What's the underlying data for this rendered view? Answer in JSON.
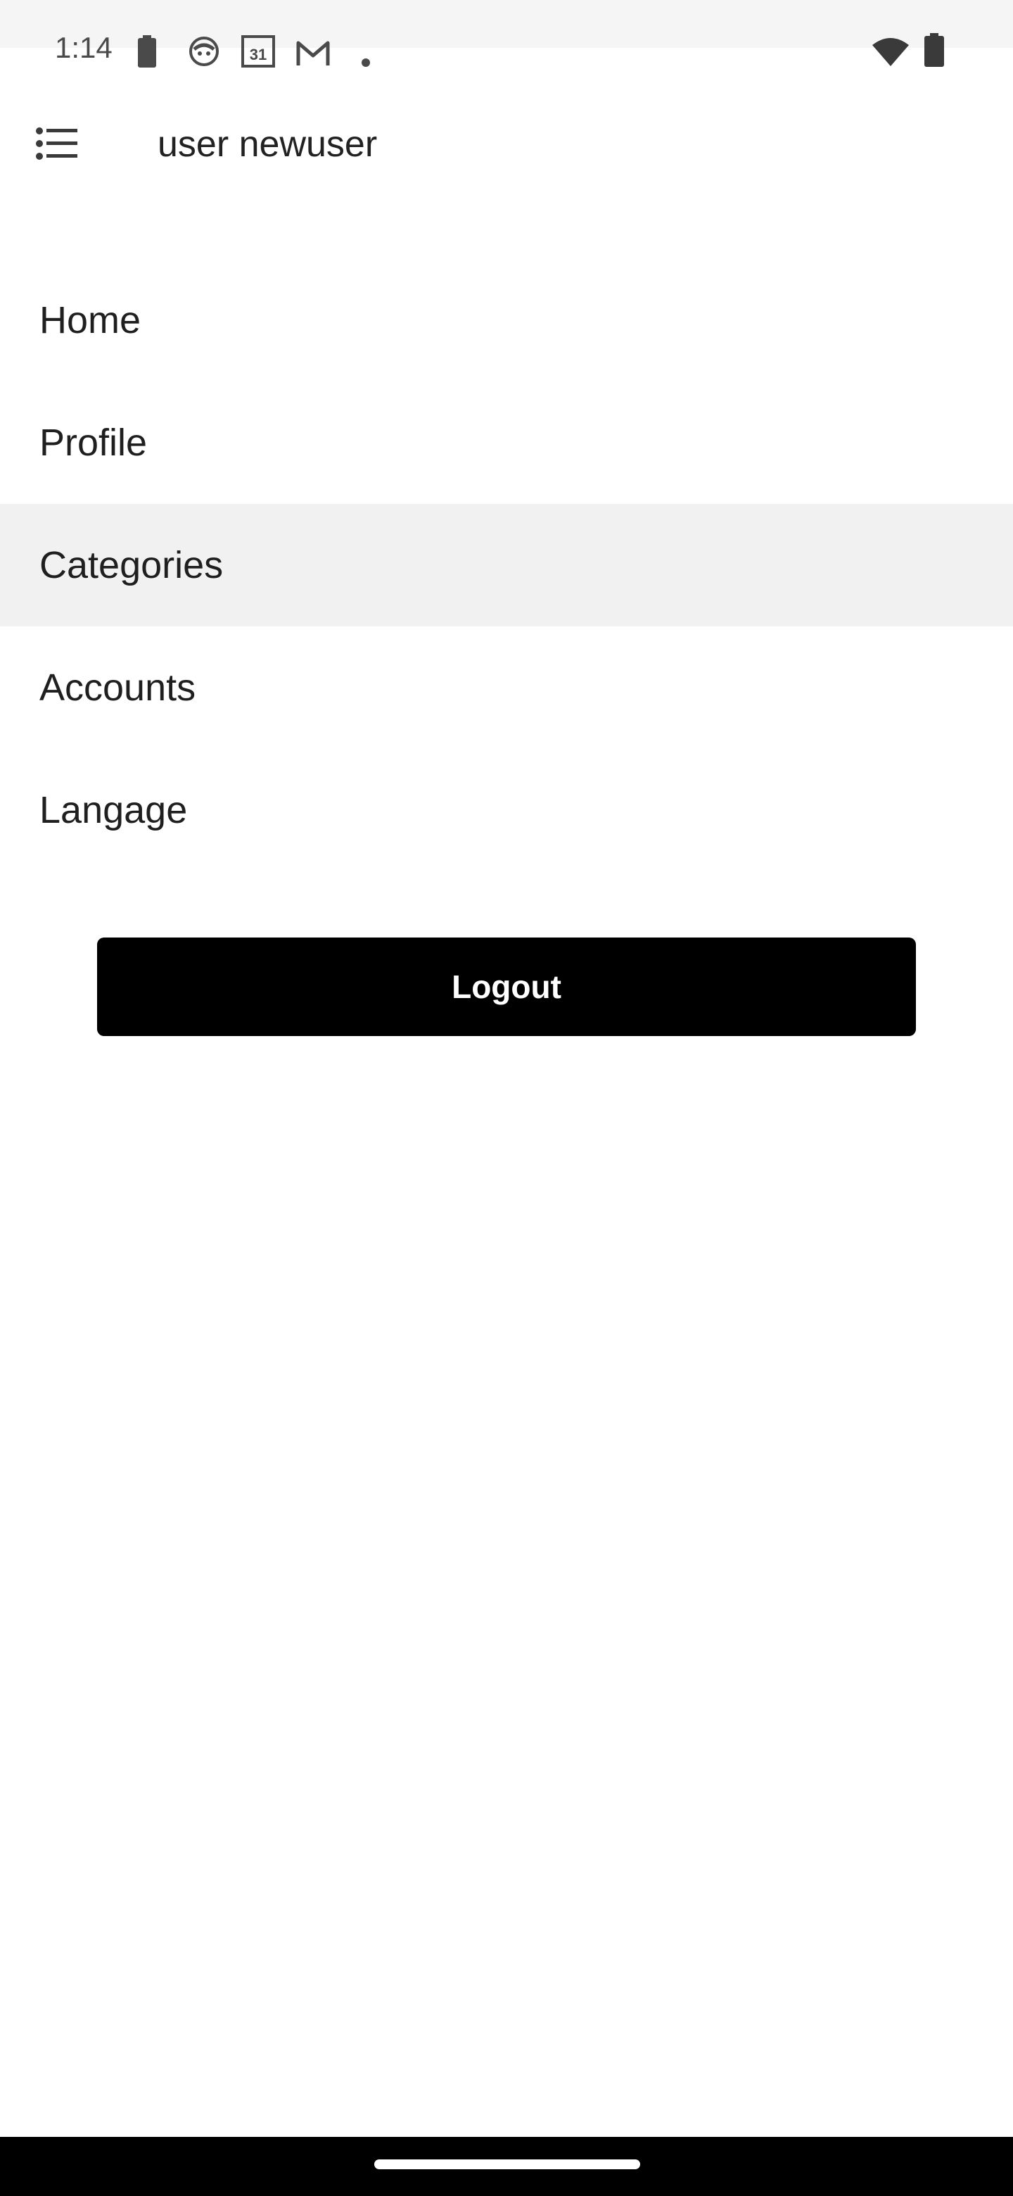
{
  "status_bar": {
    "time": "1:14",
    "icons": [
      "battery-saver-icon",
      "cat-face-icon",
      "calendar-icon",
      "gmail-icon",
      "notification-dot-icon",
      "wifi-icon",
      "battery-icon"
    ],
    "calendar_day": "31"
  },
  "app_bar": {
    "title": "user newuser",
    "menu_icon": "list-menu-icon"
  },
  "menu": {
    "items": [
      {
        "label": "Home",
        "selected": false
      },
      {
        "label": "Profile",
        "selected": false
      },
      {
        "label": "Categories",
        "selected": true
      },
      {
        "label": "Accounts",
        "selected": false
      },
      {
        "label": "Langage",
        "selected": false
      }
    ]
  },
  "logout": {
    "label": "Logout"
  },
  "colors": {
    "status_bar_bg": "#f5f5f5",
    "selected_item_bg": "#f1f1f1",
    "button_bg": "#000000",
    "button_text": "#ffffff",
    "nav_bar_bg": "#000000"
  }
}
